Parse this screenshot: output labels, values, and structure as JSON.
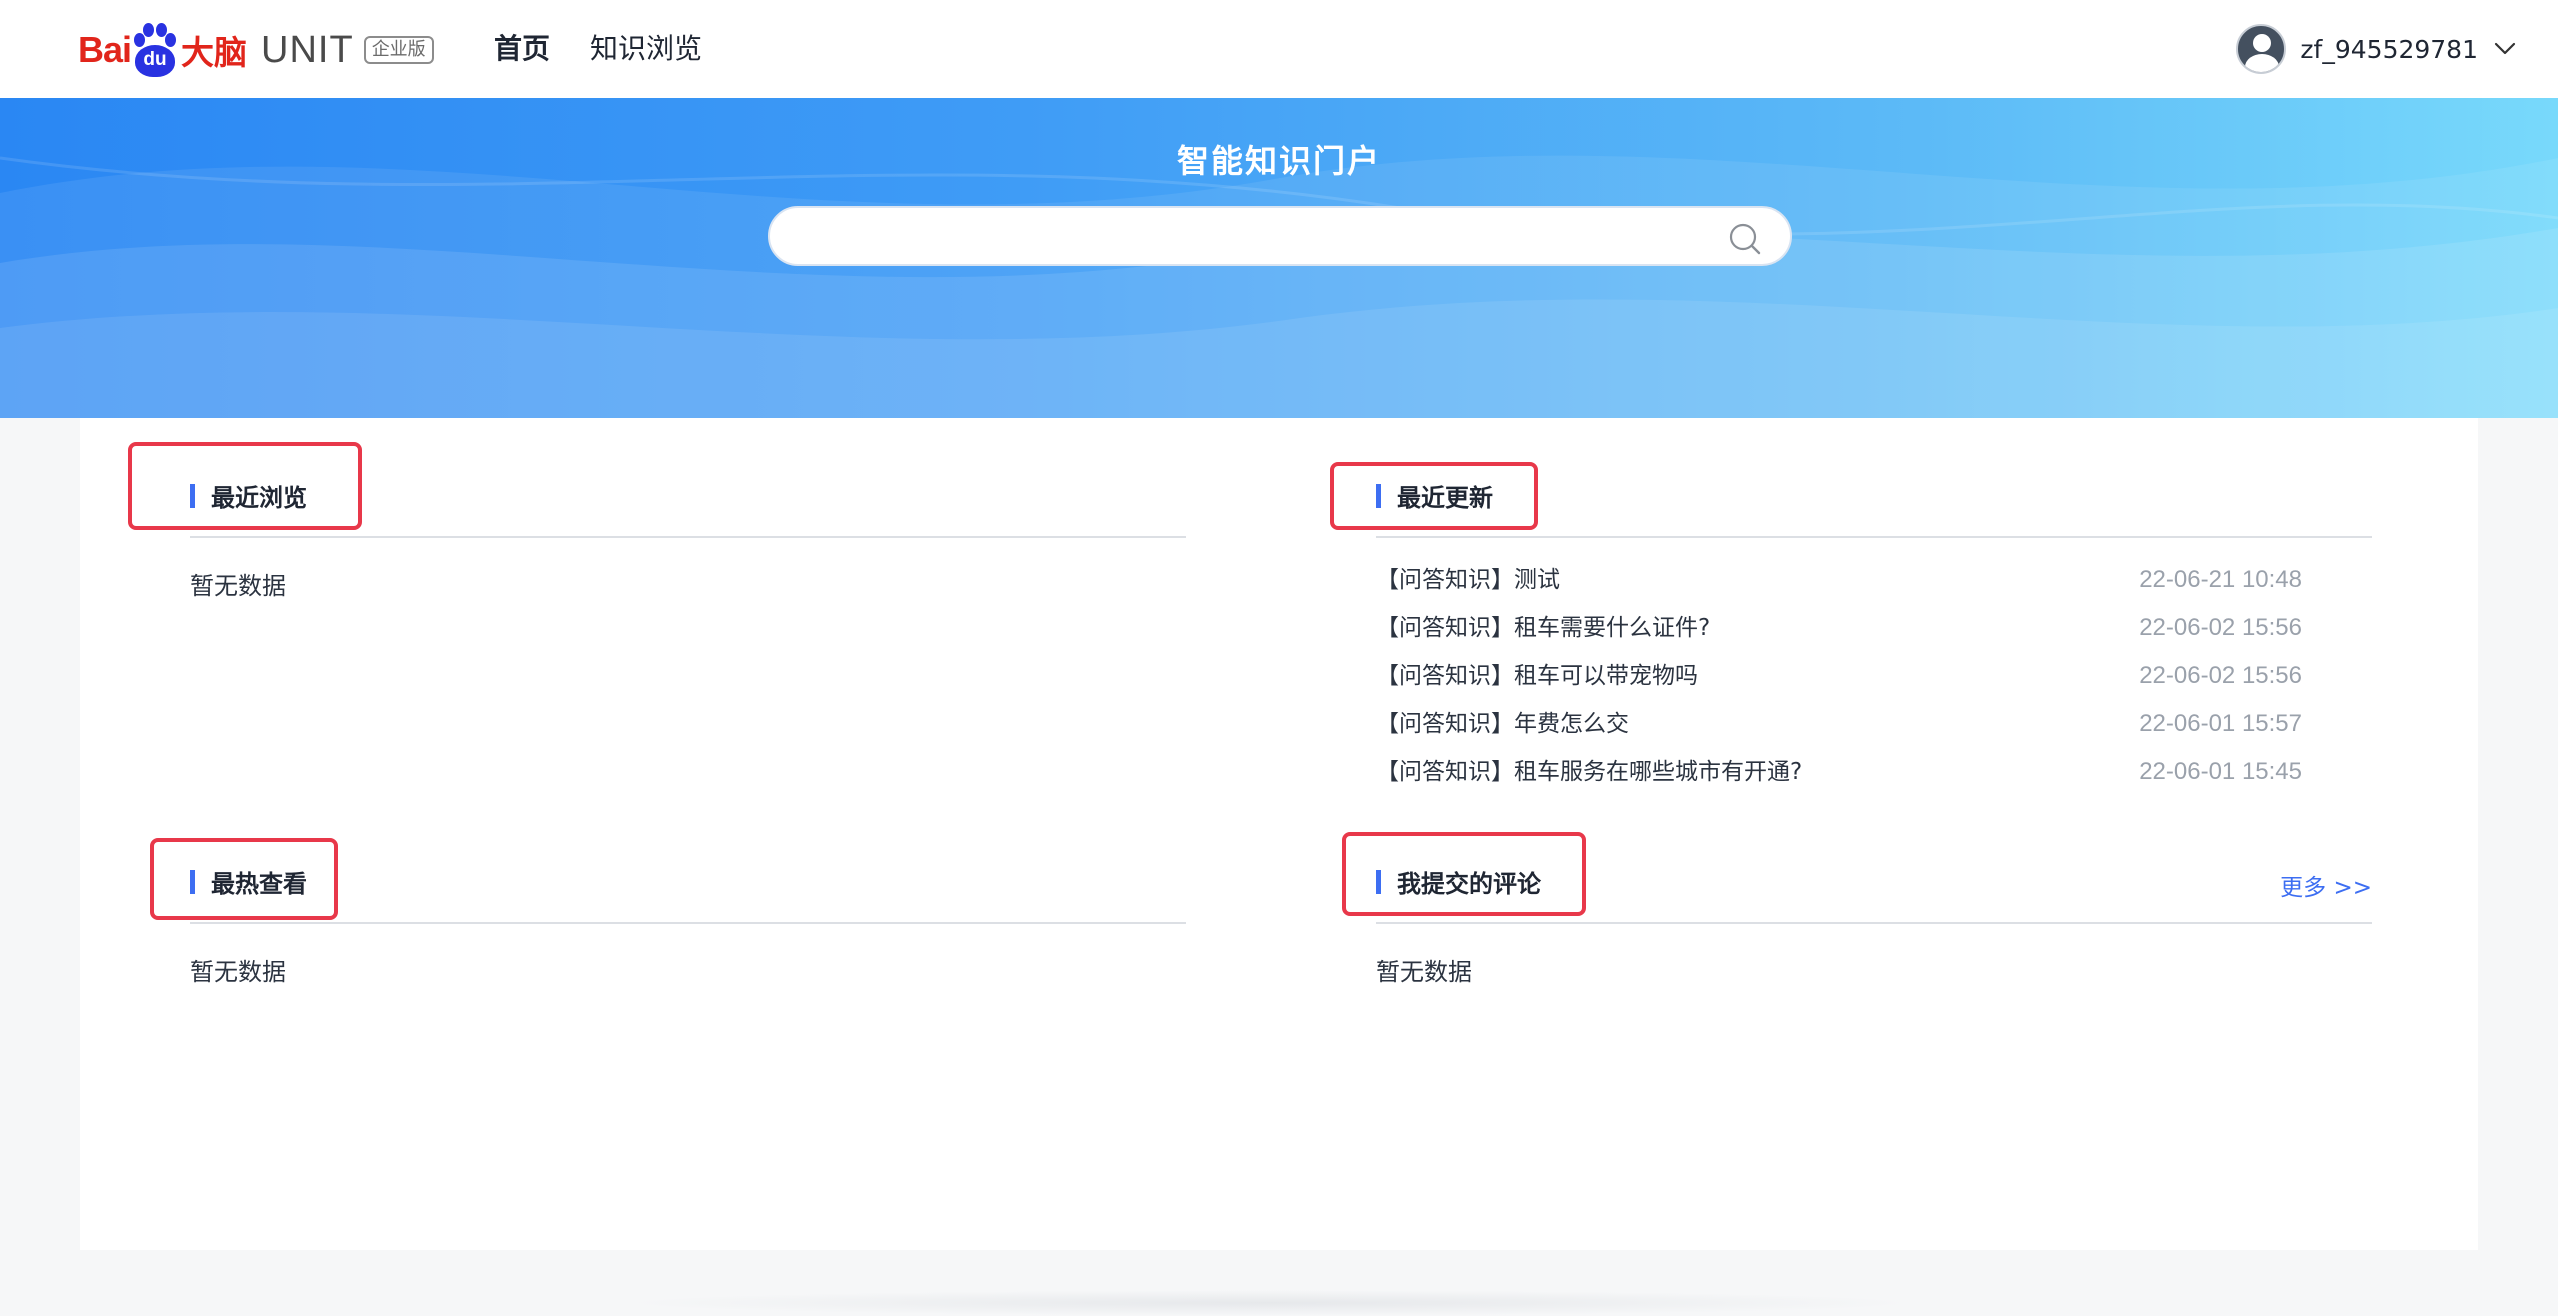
{
  "header": {
    "logo": {
      "bai": "Bai",
      "du": "du",
      "cn": "大脑",
      "unit": "UNIT",
      "edition": "企业版"
    },
    "nav": [
      {
        "label": "首页",
        "active": true
      },
      {
        "label": "知识浏览",
        "active": false
      }
    ],
    "user": {
      "name": "zf_945529781",
      "icon": "user-avatar-icon"
    }
  },
  "hero": {
    "title": "智能知识门户",
    "search": {
      "value": "",
      "placeholder": "",
      "icon": "search-icon"
    },
    "colors": {
      "gradient_start": "#2a87f3",
      "gradient_end": "#78d9fb"
    }
  },
  "sections": {
    "recent_browse": {
      "title": "最近浏览",
      "empty_text": "暂无数据"
    },
    "recent_updates": {
      "title": "最近更新",
      "items": [
        {
          "title": "【问答知识】测试",
          "time": "22-06-21 10:48"
        },
        {
          "title": "【问答知识】租车需要什么证件?",
          "time": "22-06-02 15:56"
        },
        {
          "title": "【问答知识】租车可以带宠物吗",
          "time": "22-06-02 15:56"
        },
        {
          "title": "【问答知识】年费怎么交",
          "time": "22-06-01 15:57"
        },
        {
          "title": "【问答知识】租车服务在哪些城市有开通?",
          "time": "22-06-01 15:45"
        }
      ]
    },
    "hot_views": {
      "title": "最热查看",
      "empty_text": "暂无数据"
    },
    "my_comments": {
      "title": "我提交的评论",
      "more_label": "更多 >>",
      "empty_text": "暂无数据"
    }
  },
  "colors": {
    "accent": "#3d6ef2",
    "highlight": "#e8384a",
    "brand_red": "#e1251b",
    "brand_blue": "#2932e1"
  }
}
